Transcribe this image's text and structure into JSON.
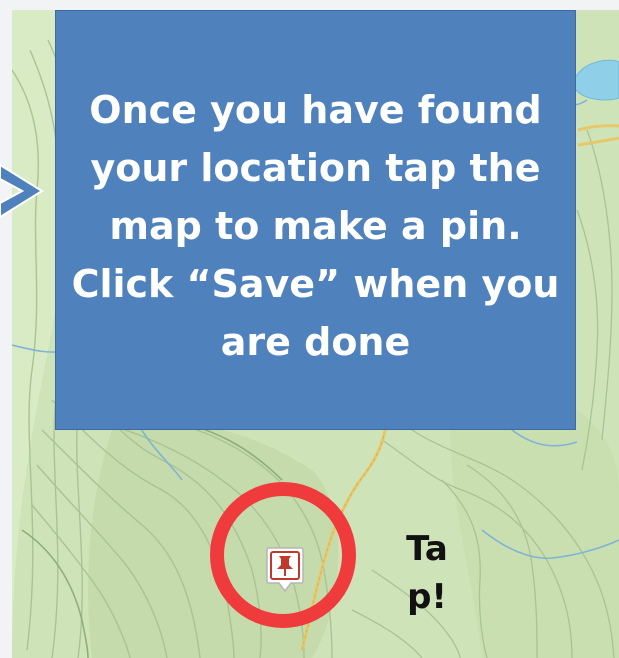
{
  "instruction": {
    "text": "Once you have found your location tap the map to make a pin. Click “Save” when you are done"
  },
  "tap_hint": {
    "text": "Tap!"
  },
  "map": {
    "terrain_color": "#cfe3b8",
    "contour_color": "#9bb78a",
    "trail_color": "#e6c86a",
    "water_color": "#8fd0e8",
    "stream_color": "#7fb4d6"
  },
  "colors": {
    "callout_fill": "#4f81bd",
    "highlight_ring": "#ef3b3b",
    "pin_color": "#c0392b"
  },
  "icons": {
    "pin": "map-pin-icon",
    "arrow": "pointer-arrow-icon"
  }
}
